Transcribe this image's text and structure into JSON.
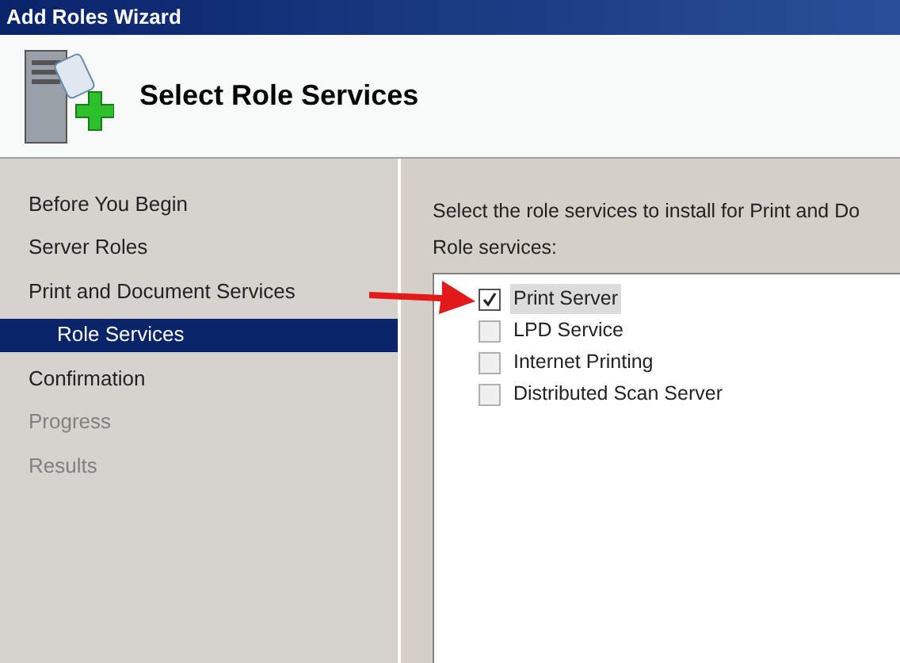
{
  "window": {
    "title": "Add Roles Wizard"
  },
  "header": {
    "title": "Select Role Services"
  },
  "steps": [
    {
      "label": "Before You Begin",
      "selected": false,
      "disabled": false
    },
    {
      "label": "Server Roles",
      "selected": false,
      "disabled": false
    },
    {
      "label": "Print and Document Services",
      "selected": false,
      "disabled": false,
      "children": [
        {
          "label": "Role Services",
          "selected": true,
          "disabled": false
        }
      ]
    },
    {
      "label": "Confirmation",
      "selected": false,
      "disabled": false
    },
    {
      "label": "Progress",
      "selected": false,
      "disabled": true
    },
    {
      "label": "Results",
      "selected": false,
      "disabled": true
    }
  ],
  "content": {
    "instruction": "Select the role services to install for Print and Do",
    "list_label": "Role services:",
    "role_services": [
      {
        "label": "Print Server",
        "checked": true,
        "selected": true
      },
      {
        "label": "LPD Service",
        "checked": false,
        "selected": false
      },
      {
        "label": "Internet Printing",
        "checked": false,
        "selected": false
      },
      {
        "label": "Distributed Scan Server",
        "checked": false,
        "selected": false
      }
    ]
  }
}
